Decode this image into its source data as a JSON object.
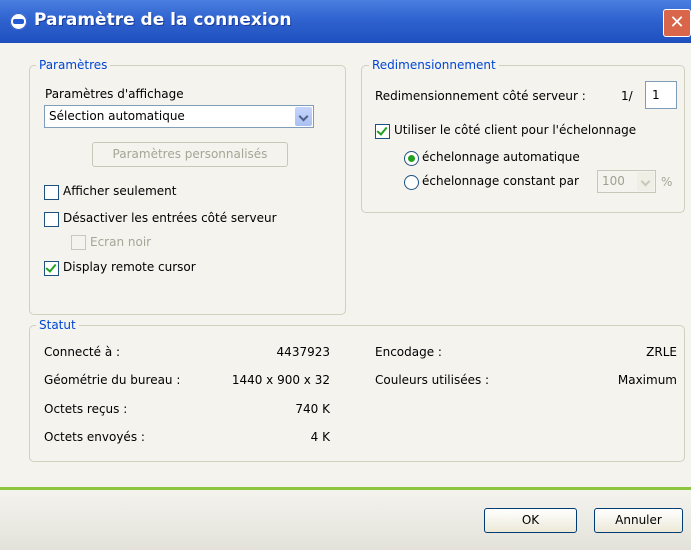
{
  "window": {
    "title": "Paramètre de la connexion",
    "close_glyph": "✕"
  },
  "parametres": {
    "legend": "Paramètres",
    "display_label": "Paramètres d'affichage",
    "display_value": "Sélection automatique",
    "custom_button": "Paramètres personnalisés",
    "view_only": {
      "label": "Afficher seulement",
      "checked": false
    },
    "disable_input": {
      "label": "Désactiver les entrées côté serveur",
      "checked": false
    },
    "black_screen": {
      "label": "Ecran noir",
      "checked": false,
      "enabled": false
    },
    "remote_cursor": {
      "label": "Display remote cursor",
      "checked": true
    }
  },
  "redim": {
    "legend": "Redimensionnement",
    "server_label": "Redimensionnement côté serveur :",
    "server_prefix": "1/",
    "server_value": "1",
    "client_scaling": {
      "label": "Utiliser le côté client pour l'échelonnage",
      "checked": true
    },
    "auto_radio": {
      "label": "échelonnage automatique",
      "selected": true
    },
    "const_radio": {
      "label": "échelonnage constant par",
      "selected": false
    },
    "percent_value": "100",
    "percent_unit": "%"
  },
  "statut": {
    "legend": "Statut",
    "left": [
      {
        "label": "Connecté à :",
        "value": "4437923"
      },
      {
        "label": "Géométrie du bureau :",
        "value": "1440 x 900 x 32"
      },
      {
        "label": "Octets reçus :",
        "value": "740 K"
      },
      {
        "label": "Octets envoyés :",
        "value": "4 K"
      }
    ],
    "right": [
      {
        "label": "Encodage :",
        "value": "ZRLE"
      },
      {
        "label": "Couleurs utilisées :",
        "value": "Maximum"
      }
    ]
  },
  "footer": {
    "ok": "OK",
    "cancel": "Annuler"
  },
  "colors": {
    "title_bar": "#2f63cf",
    "legend_text": "#0046d5",
    "accent_green": "#8cc63f",
    "check_green": "#21a121"
  }
}
